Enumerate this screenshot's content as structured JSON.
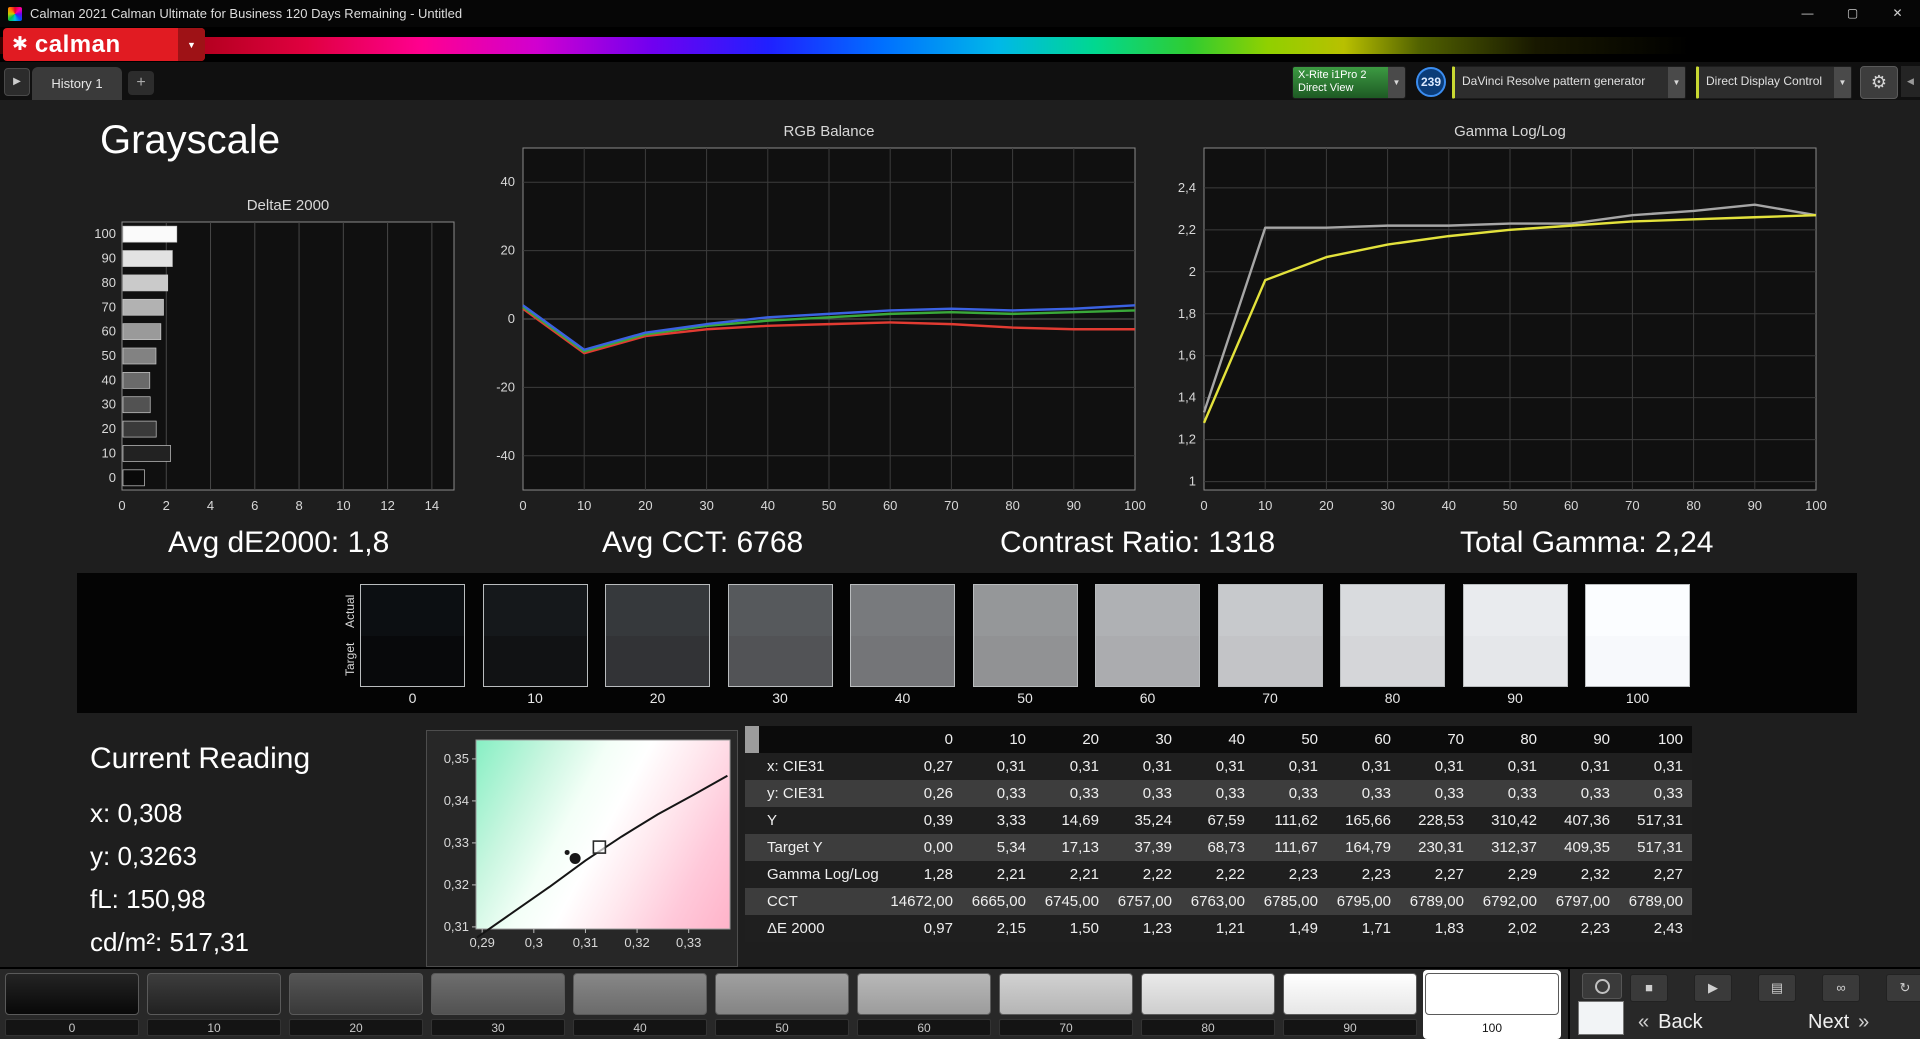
{
  "window": {
    "title": "Calman 2021 Calman Ultimate for Business 120 Days Remaining  - Untitled",
    "minimize": "—",
    "maximize": "▢",
    "close": "✕"
  },
  "brand": {
    "icon": "✱",
    "name": "calman",
    "caret": "▼"
  },
  "nav": {
    "expander": "▶",
    "history_tab": "History 1",
    "add_tab": "+"
  },
  "devices": {
    "meter_line1": "X-Rite i1Pro 2",
    "meter_line2": "Direct View",
    "meter_caret": "▼",
    "badge": "239",
    "source": "DaVinci Resolve pattern generator",
    "source_caret": "▼",
    "display": "Direct Display Control",
    "display_caret": "▼",
    "settings_icon": "⚙",
    "collapse_icon": "◀"
  },
  "page": {
    "title": "Grayscale"
  },
  "stats": {
    "de": "Avg dE2000: 1,8",
    "cct": "Avg CCT: 6768",
    "contrast": "Contrast Ratio: 1318",
    "gamma": "Total Gamma: 2,24"
  },
  "chart_data": [
    {
      "type": "bar",
      "orientation": "horizontal",
      "title": "DeltaE 2000",
      "categories": [
        "100",
        "90",
        "80",
        "70",
        "60",
        "50",
        "40",
        "30",
        "20",
        "10",
        "0"
      ],
      "values": [
        2.43,
        2.23,
        2.02,
        1.83,
        1.71,
        1.49,
        1.21,
        1.23,
        1.5,
        2.15,
        0.97
      ],
      "bar_levels": [
        100,
        90,
        80,
        70,
        60,
        50,
        40,
        30,
        20,
        10,
        0
      ],
      "xlim": [
        0,
        15
      ],
      "xticks": [
        0,
        2,
        4,
        6,
        8,
        10,
        12,
        14
      ],
      "xlabel": "",
      "ylabel": ""
    },
    {
      "type": "line",
      "title": "RGB Balance",
      "x": [
        0,
        10,
        20,
        30,
        40,
        50,
        60,
        70,
        80,
        90,
        100
      ],
      "ylim": [
        -50,
        50
      ],
      "yticks": [
        {
          "v": 40,
          "label": "40"
        },
        {
          "v": 20,
          "label": "20"
        },
        {
          "v": 0,
          "label": "0"
        },
        {
          "v": -20,
          "label": "-20"
        },
        {
          "v": -40,
          "label": "-40"
        }
      ],
      "xticks": [
        {
          "v": 0,
          "label": "0"
        },
        {
          "v": 10,
          "label": "10"
        },
        {
          "v": 20,
          "label": "20"
        },
        {
          "v": 30,
          "label": "30"
        },
        {
          "v": 40,
          "label": "40"
        },
        {
          "v": 50,
          "label": "50"
        },
        {
          "v": 60,
          "label": "60"
        },
        {
          "v": 70,
          "label": "70"
        },
        {
          "v": 80,
          "label": "80"
        },
        {
          "v": 90,
          "label": "90"
        },
        {
          "v": 100,
          "label": "100"
        }
      ],
      "series": [
        {
          "name": "red",
          "color": "#e23b32",
          "values": [
            3,
            -10,
            -5,
            -3,
            -2,
            -1.5,
            -1,
            -1.5,
            -2.5,
            -3,
            -3
          ]
        },
        {
          "name": "green",
          "color": "#3aa83a",
          "values": [
            3.5,
            -9.5,
            -4.5,
            -2,
            -0.5,
            0.5,
            1.5,
            2,
            1.5,
            2,
            2.5
          ]
        },
        {
          "name": "blue",
          "color": "#3b62e2",
          "values": [
            4,
            -9,
            -4,
            -1.5,
            0.5,
            1.5,
            2.5,
            3,
            2.5,
            3,
            4
          ]
        }
      ]
    },
    {
      "type": "line",
      "title": "Gamma Log/Log",
      "x": [
        0,
        10,
        20,
        30,
        40,
        50,
        60,
        70,
        80,
        90,
        100
      ],
      "ylim": [
        0.96,
        2.59
      ],
      "yticks": [
        {
          "v": 2.4,
          "label": "2,4"
        },
        {
          "v": 2.2,
          "label": "2,2"
        },
        {
          "v": 2.0,
          "label": "2"
        },
        {
          "v": 1.8,
          "label": "1,8"
        },
        {
          "v": 1.6,
          "label": "1,6"
        },
        {
          "v": 1.4,
          "label": "1,4"
        },
        {
          "v": 1.2,
          "label": "1,2"
        },
        {
          "v": 1.0,
          "label": "1"
        }
      ],
      "xticks": [
        {
          "v": 0,
          "label": "0"
        },
        {
          "v": 10,
          "label": "10"
        },
        {
          "v": 20,
          "label": "20"
        },
        {
          "v": 30,
          "label": "30"
        },
        {
          "v": 40,
          "label": "40"
        },
        {
          "v": 50,
          "label": "50"
        },
        {
          "v": 60,
          "label": "60"
        },
        {
          "v": 70,
          "label": "70"
        },
        {
          "v": 80,
          "label": "80"
        },
        {
          "v": 90,
          "label": "90"
        },
        {
          "v": 100,
          "label": "100"
        }
      ],
      "series": [
        {
          "name": "reference",
          "color": "#a6a6a6",
          "values": [
            1.33,
            2.21,
            2.21,
            2.22,
            2.22,
            2.23,
            2.23,
            2.27,
            2.29,
            2.32,
            2.27
          ]
        },
        {
          "name": "measured",
          "color": "#e3e23c",
          "values": [
            1.28,
            1.96,
            2.07,
            2.13,
            2.17,
            2.2,
            2.22,
            2.24,
            2.25,
            2.26,
            2.27
          ]
        }
      ]
    },
    {
      "type": "scatter",
      "title": "",
      "xlim": [
        0.2888,
        0.338
      ],
      "ylim": [
        0.3095,
        0.3545
      ],
      "xticks": [
        {
          "v": 0.29,
          "label": "0,29"
        },
        {
          "v": 0.3,
          "label": "0,3"
        },
        {
          "v": 0.31,
          "label": "0,31"
        },
        {
          "v": 0.32,
          "label": "0,32"
        },
        {
          "v": 0.33,
          "label": "0,33"
        }
      ],
      "yticks": [
        {
          "v": 0.35,
          "label": "0,35"
        },
        {
          "v": 0.34,
          "label": "0,34"
        },
        {
          "v": 0.33,
          "label": "0,33"
        },
        {
          "v": 0.32,
          "label": "0,32"
        },
        {
          "v": 0.31,
          "label": "0,31"
        }
      ],
      "locus": [
        [
          0.289,
          0.3075
        ],
        [
          0.296,
          0.3135
        ],
        [
          0.303,
          0.3195
        ],
        [
          0.31,
          0.3258
        ],
        [
          0.317,
          0.3315
        ],
        [
          0.324,
          0.3368
        ],
        [
          0.331,
          0.3415
        ],
        [
          0.3375,
          0.346
        ]
      ],
      "measured": {
        "x": 0.308,
        "y": 0.3263
      },
      "target": {
        "x": 0.3127,
        "y": 0.329
      }
    }
  ],
  "swatches": {
    "actual_label": "Actual",
    "target_label": "Target",
    "levels": [
      "0",
      "10",
      "20",
      "30",
      "40",
      "50",
      "60",
      "70",
      "80",
      "90",
      "100"
    ],
    "actual_colors": [
      "#0c0f12",
      "#15181b",
      "#36393c",
      "#56595c",
      "#787a7d",
      "#959799",
      "#afb1b4",
      "#c7c9cc",
      "#d9dbde",
      "#e9ebee",
      "#fbfdff"
    ],
    "target_colors": [
      "#08090b",
      "#111214",
      "#323336",
      "#525356",
      "#747578",
      "#919294",
      "#abacaf",
      "#c3c4c7",
      "#d5d6d9",
      "#e5e7ea",
      "#f7f9fc"
    ]
  },
  "current_reading": {
    "title": "Current Reading",
    "lines": [
      "x: 0,308",
      "y: 0,3263",
      "fL: 150,98",
      "cd/m²: 517,31"
    ]
  },
  "table": {
    "headers": [
      "0",
      "10",
      "20",
      "30",
      "40",
      "50",
      "60",
      "70",
      "80",
      "90",
      "100"
    ],
    "rows": [
      {
        "label": "x: CIE31",
        "values": [
          "0,27",
          "0,31",
          "0,31",
          "0,31",
          "0,31",
          "0,31",
          "0,31",
          "0,31",
          "0,31",
          "0,31",
          "0,31"
        ]
      },
      {
        "label": "y: CIE31",
        "values": [
          "0,26",
          "0,33",
          "0,33",
          "0,33",
          "0,33",
          "0,33",
          "0,33",
          "0,33",
          "0,33",
          "0,33",
          "0,33"
        ]
      },
      {
        "label": "Y",
        "values": [
          "0,39",
          "3,33",
          "14,69",
          "35,24",
          "67,59",
          "111,62",
          "165,66",
          "228,53",
          "310,42",
          "407,36",
          "517,31"
        ]
      },
      {
        "label": "Target Y",
        "values": [
          "0,00",
          "5,34",
          "17,13",
          "37,39",
          "68,73",
          "111,67",
          "164,79",
          "230,31",
          "312,37",
          "409,35",
          "517,31"
        ]
      },
      {
        "label": "Gamma Log/Log",
        "values": [
          "1,28",
          "2,21",
          "2,21",
          "2,22",
          "2,22",
          "2,23",
          "2,23",
          "2,27",
          "2,29",
          "2,32",
          "2,27"
        ]
      },
      {
        "label": "CCT",
        "values": [
          "14672,00",
          "6665,00",
          "6745,00",
          "6757,00",
          "6763,00",
          "6785,00",
          "6795,00",
          "6789,00",
          "6792,00",
          "6797,00",
          "6789,00"
        ]
      },
      {
        "label": "ΔE 2000",
        "values": [
          "0,97",
          "2,15",
          "1,50",
          "1,23",
          "1,21",
          "1,49",
          "1,71",
          "1,83",
          "2,02",
          "2,23",
          "2,43"
        ]
      }
    ]
  },
  "footer": {
    "patches": [
      "0",
      "10",
      "20",
      "30",
      "40",
      "50",
      "60",
      "70",
      "80",
      "90",
      "100"
    ],
    "selected_index": 10,
    "icons": {
      "stop": "■",
      "play": "▶",
      "window": "▤",
      "link": "∞",
      "refresh": "↻"
    },
    "back_arrow": "«",
    "back": "Back",
    "next": "Next",
    "next_arrow": "»"
  }
}
